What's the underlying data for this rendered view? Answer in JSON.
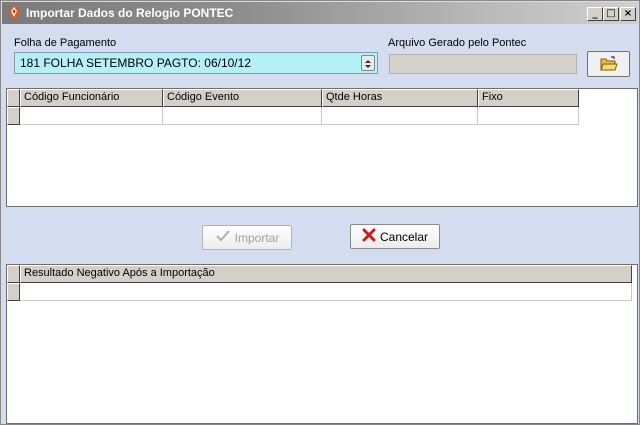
{
  "window": {
    "title": "Importar Dados do Relogio PONTEC",
    "controls": {
      "minimize": "_",
      "maximize": "□",
      "close": "×"
    }
  },
  "form": {
    "payroll_label": "Folha de Pagamento",
    "payroll_value": "181 FOLHA SETEMBRO PAGTO:  06/10/12",
    "file_label": "Arquivo  Gerado pelo  Pontec",
    "file_value": ""
  },
  "import_grid": {
    "columns": [
      "Código Funcionário",
      "Código Evento",
      "Qtde Horas",
      "Fixo"
    ]
  },
  "actions": {
    "import_label": "Importar",
    "cancel_label": "Cancelar"
  },
  "result_grid": {
    "columns": [
      "Resultado Negativo Após a Importação"
    ]
  },
  "colors": {
    "background": "#d4dcf0",
    "combo_fill": "#b6f0f7",
    "cancel_icon": "#cc1a1a"
  },
  "icons": {
    "app": "app-logo-icon",
    "open": "open-folder-icon",
    "import": "checkmark-icon",
    "cancel": "x-icon",
    "combo": "spinner-arrows-icon"
  }
}
